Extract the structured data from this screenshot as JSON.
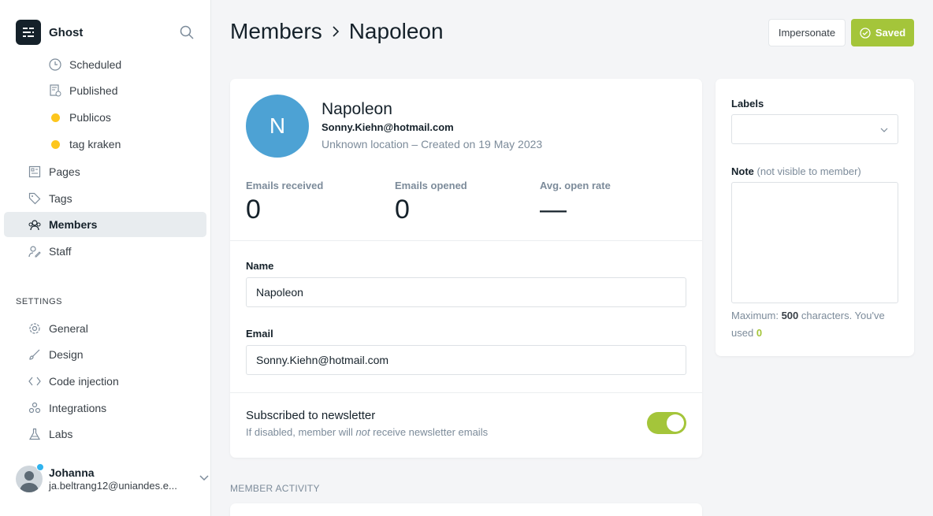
{
  "sidebar": {
    "brand": "Ghost",
    "posts_sub": [
      {
        "label": "Scheduled",
        "icon": "clock-icon"
      },
      {
        "label": "Published",
        "icon": "published-icon"
      },
      {
        "label": "Publicos",
        "icon": "yellow-dot-icon"
      },
      {
        "label": "tag kraken",
        "icon": "yellow-dot-icon"
      }
    ],
    "main_items": [
      {
        "label": "Pages",
        "icon": "pages-icon"
      },
      {
        "label": "Tags",
        "icon": "tag-icon"
      },
      {
        "label": "Members",
        "icon": "members-icon",
        "active": true
      },
      {
        "label": "Staff",
        "icon": "staff-icon"
      }
    ],
    "settings_title": "SETTINGS",
    "settings_items": [
      {
        "label": "General",
        "icon": "gear-icon"
      },
      {
        "label": "Design",
        "icon": "brush-icon"
      },
      {
        "label": "Code injection",
        "icon": "code-icon"
      },
      {
        "label": "Integrations",
        "icon": "integrations-icon"
      },
      {
        "label": "Labs",
        "icon": "flask-icon"
      }
    ],
    "user": {
      "name": "Johanna",
      "email": "ja.beltrang12@uniandes.e..."
    }
  },
  "header": {
    "crumb_parent": "Members",
    "crumb_current": "Napoleon",
    "impersonate_label": "Impersonate",
    "saved_label": "Saved"
  },
  "member": {
    "initial": "N",
    "name": "Napoleon",
    "email": "Sonny.Kiehn@hotmail.com",
    "meta": "Unknown location – Created on 19 May 2023",
    "stats": [
      {
        "label": "Emails received",
        "value": "0"
      },
      {
        "label": "Emails opened",
        "value": "0"
      },
      {
        "label": "Avg. open rate",
        "value": "—"
      }
    ],
    "name_label": "Name",
    "name_value": "Napoleon",
    "email_label": "Email",
    "email_value": "Sonny.Kiehn@hotmail.com",
    "newsletter_title": "Subscribed to newsletter",
    "newsletter_desc_a": "If disabled, member will ",
    "newsletter_desc_em": "not",
    "newsletter_desc_b": " receive newsletter emails",
    "newsletter_enabled": true
  },
  "side": {
    "labels_label": "Labels",
    "note_label": "Note",
    "note_hint": "(not visible to member)",
    "count_prefix": "Maximum: ",
    "count_max": "500",
    "count_mid": " characters. You've used ",
    "count_used": "0"
  },
  "activity_title": "MEMBER ACTIVITY",
  "colors": {
    "accent": "#a4c53a",
    "avatar": "#4da2d4",
    "tag_dot": "#fdc61d"
  }
}
